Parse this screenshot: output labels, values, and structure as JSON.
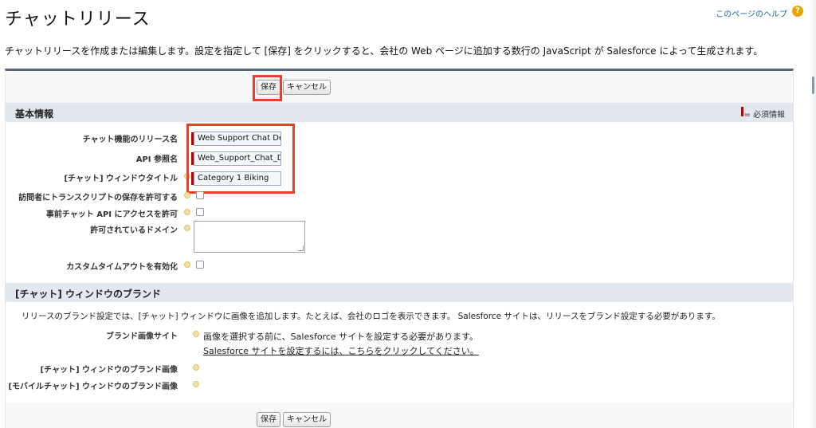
{
  "header": {
    "title": "チャットリリース",
    "help_link": "このページのヘルプ",
    "help_icon": "question-mark-icon",
    "intro": "チャットリリースを作成または編集します。設定を指定して [保存] をクリックすると、会社の Web ページに追加する数行の JavaScript が Salesforce によって生成されます。"
  },
  "top_buttons": {
    "save": "保存",
    "cancel": "キャンセル"
  },
  "basic_info": {
    "title": "基本情報",
    "required_legend": "= 必須情報",
    "fields": {
      "release_name": {
        "label": "チャット機能のリリース名",
        "value": "Web Support Chat Deployment"
      },
      "api_name": {
        "label": "API 参照名",
        "value": "Web_Support_Chat_Deployment"
      },
      "window_title": {
        "label": "[チャット] ウィンドウタイトル",
        "value": "Category 1 Biking"
      },
      "allow_transcript": {
        "label": "訪問者にトランスクリプトの保存を許可する",
        "checked": false
      },
      "prechat_api": {
        "label": "事前チャット API にアクセスを許可",
        "checked": false
      },
      "allowed_domains": {
        "label": "許可されているドメイン",
        "value": ""
      },
      "custom_timeout": {
        "label": "カスタムタイムアウトを有効化",
        "checked": false
      }
    }
  },
  "branding": {
    "title": "[チャット] ウィンドウのブランド",
    "description": "リリースのブランド設定では、[チャット] ウィンドウに画像を追加します。たとえば、会社のロゴを表示できます。 Salesforce サイトは、リリースをブランド設定する必要があります。",
    "brand_site_label": "ブランド画像サイト",
    "brand_site_text": "画像を選択する前に、Salesforce サイトを設定する必要があります。",
    "brand_site_link": "Salesforce サイトを設定するには、こちらをクリックしてください。",
    "window_image_label": "[チャット] ウィンドウのブランド画像",
    "mobile_image_label": "[モバイルチャット] ウィンドウのブランド画像"
  },
  "bottom_buttons": {
    "save": "保存",
    "cancel": "キャンセル"
  },
  "colors": {
    "accent_border": "#58667a",
    "section_bg": "#e3e7ef",
    "required_red": "#c00000",
    "highlight_red": "#e8402a",
    "help_orange": "#e8a400"
  }
}
